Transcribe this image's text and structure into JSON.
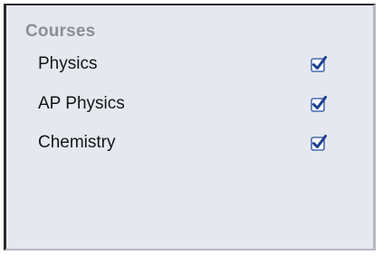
{
  "section": {
    "title": "Courses"
  },
  "courses": [
    {
      "label": "Physics",
      "checked": true
    },
    {
      "label": "AP Physics",
      "checked": true
    },
    {
      "label": "Chemistry",
      "checked": true
    }
  ],
  "colors": {
    "panel_background": "#e5e8ef",
    "title_text": "#8a8e97",
    "checkmark": "#1f3f8f",
    "checkbox_border": "#4a6ab0"
  },
  "icons": {
    "checkbox": "checkbox-checked-icon"
  }
}
